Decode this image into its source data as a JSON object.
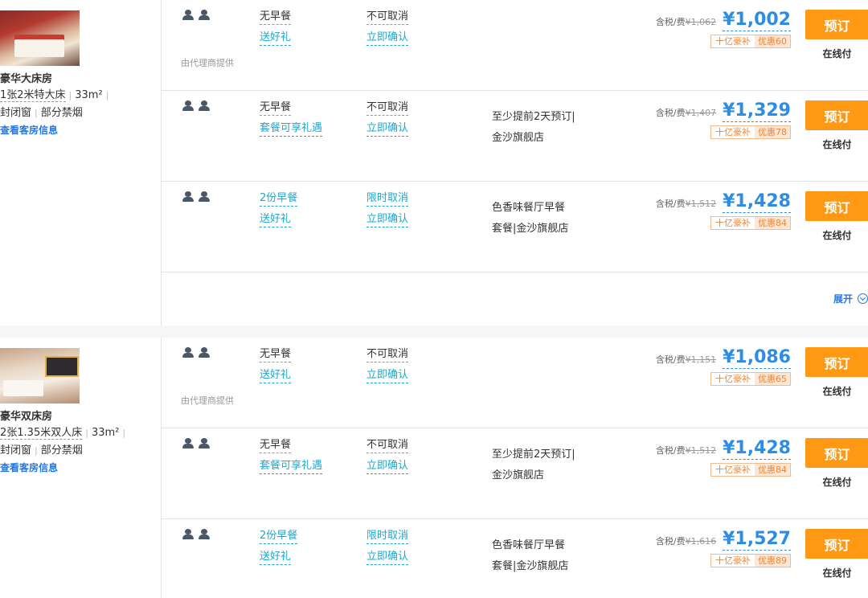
{
  "rooms": [
    {
      "name": "豪华大床房",
      "bed": "1张2米特大床",
      "area": "33m²",
      "window": "封闭窗",
      "smoking": "部分禁烟",
      "link": "查看客房信息",
      "plans": [
        {
          "meal": "无早餐",
          "meal_teal": false,
          "perk": "送好礼",
          "cancel": "不可取消",
          "cancel_teal": false,
          "confirm": "立即确认",
          "note1": "",
          "note2": "",
          "agent": "由代理商提供",
          "tax_label": "含税/费",
          "orig": "¥1,062",
          "price": "¥1,002",
          "badge1": "十亿豪补",
          "badge2": "优惠60",
          "book": "预订",
          "pay": "在线付"
        },
        {
          "meal": "无早餐",
          "meal_teal": false,
          "perk": "套餐可享礼遇",
          "cancel": "不可取消",
          "cancel_teal": false,
          "confirm": "立即确认",
          "note1": "至少提前2天预订|",
          "note2": "金沙旗舰店",
          "agent": "",
          "tax_label": "含税/费",
          "orig": "¥1,407",
          "price": "¥1,329",
          "badge1": "十亿豪补",
          "badge2": "优惠78",
          "book": "预订",
          "pay": "在线付"
        },
        {
          "meal": "2份早餐",
          "meal_teal": true,
          "perk": "送好礼",
          "cancel": "限时取消",
          "cancel_teal": true,
          "confirm": "立即确认",
          "note1": "色香味餐厅早餐",
          "note2": "套餐|金沙旗舰店",
          "agent": "",
          "tax_label": "含税/费",
          "orig": "¥1,512",
          "price": "¥1,428",
          "badge1": "十亿豪补",
          "badge2": "优惠84",
          "book": "预订",
          "pay": "在线付"
        }
      ],
      "expand": "展开"
    },
    {
      "name": "豪华双床房",
      "bed": "2张1.35米双人床",
      "area": "33m²",
      "window": "封闭窗",
      "smoking": "部分禁烟",
      "link": "查看客房信息",
      "plans": [
        {
          "meal": "无早餐",
          "meal_teal": false,
          "perk": "送好礼",
          "cancel": "不可取消",
          "cancel_teal": false,
          "confirm": "立即确认",
          "note1": "",
          "note2": "",
          "agent": "由代理商提供",
          "tax_label": "含税/费",
          "orig": "¥1,151",
          "price": "¥1,086",
          "badge1": "十亿豪补",
          "badge2": "优惠65",
          "book": "预订",
          "pay": "在线付"
        },
        {
          "meal": "无早餐",
          "meal_teal": false,
          "perk": "套餐可享礼遇",
          "cancel": "不可取消",
          "cancel_teal": false,
          "confirm": "立即确认",
          "note1": "至少提前2天预订|",
          "note2": "金沙旗舰店",
          "agent": "",
          "tax_label": "含税/费",
          "orig": "¥1,512",
          "price": "¥1,428",
          "badge1": "十亿豪补",
          "badge2": "优惠84",
          "book": "预订",
          "pay": "在线付"
        },
        {
          "meal": "2份早餐",
          "meal_teal": true,
          "perk": "送好礼",
          "cancel": "限时取消",
          "cancel_teal": true,
          "confirm": "立即确认",
          "note1": "色香味餐厅早餐",
          "note2": "套餐|金沙旗舰店",
          "agent": "",
          "tax_label": "含税/费",
          "orig": "¥1,616",
          "price": "¥1,527",
          "badge1": "十亿豪补",
          "badge2": "优惠89",
          "book": "预订",
          "pay": "在线付"
        }
      ]
    }
  ]
}
